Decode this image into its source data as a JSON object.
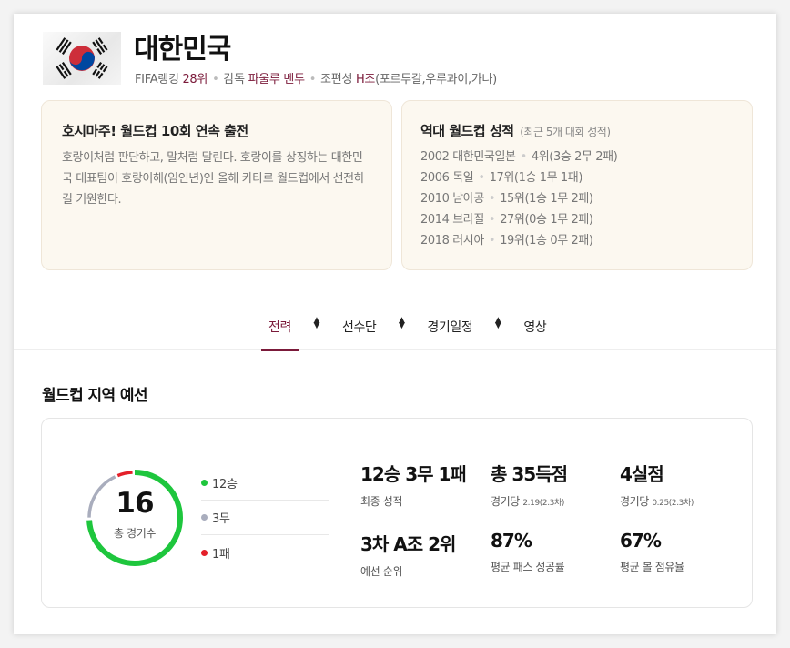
{
  "team": {
    "name": "대한민국",
    "meta": {
      "fifa_label": "FIFA랭킹",
      "fifa_rank": "28위",
      "coach_label": "감독",
      "coach_name": "파울루 벤투",
      "group_label": "조편성",
      "group_name": "H조",
      "group_teams": "(포르투갈,우루과이,가나)"
    }
  },
  "box_intro": {
    "title": "호시마주! 월드컵 10회 연속 출전",
    "desc": "호랑이처럼 판단하고, 말처럼 달린다. 호랑이를 상징하는 대한민국 대표팀이 호랑이해(임인년)인 올해 카타르 월드컵에서 선전하길 기원한다."
  },
  "box_history": {
    "title": "역대 월드컵 성적",
    "subtitle": "(최근 5개 대회 성적)",
    "items": [
      {
        "event": "2002 대한민국일본",
        "result": "4위(3승 2무 2패)"
      },
      {
        "event": "2006 독일",
        "result": "17위(1승 1무 1패)"
      },
      {
        "event": "2010 남아공",
        "result": "15위(1승 1무 2패)"
      },
      {
        "event": "2014 브라질",
        "result": "27위(0승 1무 2패)"
      },
      {
        "event": "2018 러시아",
        "result": "19위(1승 0무 2패)"
      }
    ]
  },
  "tabs": [
    "전력",
    "선수단",
    "경기일정",
    "영상"
  ],
  "section": {
    "title": "월드컵 지역 예선"
  },
  "summary": {
    "total_games": "16",
    "total_label": "총 경기수",
    "wins": 12,
    "draws": 3,
    "losses": 1,
    "legend": [
      {
        "label": "12승",
        "color": "#1ec63d"
      },
      {
        "label": "3무",
        "color": "#a9adbd"
      },
      {
        "label": "1패",
        "color": "#e4202a"
      }
    ]
  },
  "stats": [
    {
      "value": "12승 3무 1패",
      "label": "최종 성적",
      "note": ""
    },
    {
      "value": "총 35득점",
      "label": "경기당",
      "note": "2.19(2.3차)"
    },
    {
      "value": "4실점",
      "label": "경기당",
      "note": "0.25(2.3차)"
    },
    {
      "value": "3차 A조 2위",
      "label": "예선 순위",
      "note": ""
    },
    {
      "value": "87%",
      "label": "평균 패스 성공률",
      "note": ""
    },
    {
      "value": "67%",
      "label": "평균 볼 점유율",
      "note": ""
    }
  ]
}
